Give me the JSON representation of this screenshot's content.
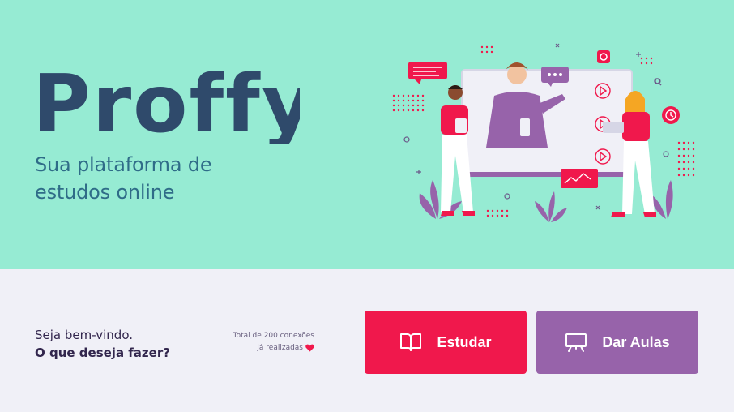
{
  "brand": {
    "name": "Proffy",
    "tagline_line1": "Sua plataforma de",
    "tagline_line2": "estudos online"
  },
  "welcome": {
    "greeting": "Seja bem-vindo.",
    "question": "O que deseja fazer?"
  },
  "connections": {
    "line1": "Total de 200 conexões",
    "line2": "já realizadas"
  },
  "actions": {
    "study_label": "Estudar",
    "teach_label": "Dar Aulas"
  },
  "colors": {
    "hero_background": "#96ebd3",
    "page_background": "#f0f0f7",
    "logo": "#2f4a6b",
    "study_button": "#f0184c",
    "teach_button": "#9763aa"
  },
  "icons": {
    "study": "book-open-icon",
    "teach": "presentation-board-icon",
    "heart": "heart-icon"
  }
}
